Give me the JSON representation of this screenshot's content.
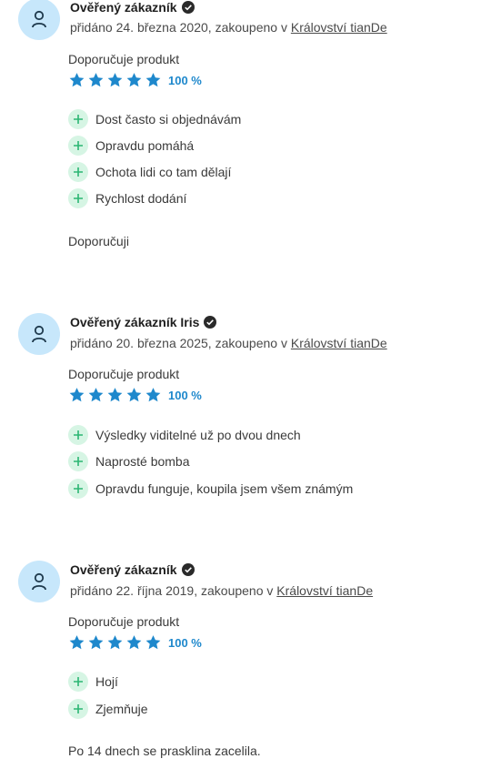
{
  "reviews": [
    {
      "author": "Ověřený zákazník",
      "meta_prefix": "přidáno 24. března 2020, zakoupeno v ",
      "store": "Království tianDe",
      "recommend": "Doporučuje produkt",
      "rating_percent": "100 %",
      "stars": 5,
      "pros": [
        "Dost často si objednávám",
        "Opravdu pomáhá",
        "Ochota lidi co tam dělají",
        "Rychlost dodání"
      ],
      "comment": "Doporučuji"
    },
    {
      "author": "Ověřený zákazník Iris",
      "meta_prefix": "přidáno 20. března 2025, zakoupeno v ",
      "store": "Království tianDe",
      "recommend": "Doporučuje produkt",
      "rating_percent": "100 %",
      "stars": 5,
      "pros": [
        "Výsledky viditelné už po dvou dnech",
        "Naprosté bomba",
        "Opravdu funguje, koupila jsem všem známým"
      ],
      "comment": ""
    },
    {
      "author": "Ověřený zákazník",
      "meta_prefix": "přidáno 22. října 2019, zakoupeno v ",
      "store": "Království tianDe",
      "recommend": "Doporučuje produkt",
      "rating_percent": "100 %",
      "stars": 5,
      "pros": [
        "Hojí",
        "Zjemňuje"
      ],
      "comment": "Po 14 dnech se prasklina zacelila."
    }
  ],
  "colors": {
    "avatar_bg": "#c7e7fb",
    "star": "#1e88cc",
    "plus_bg": "#d6f5e4",
    "plus_icon": "#2bb673"
  }
}
